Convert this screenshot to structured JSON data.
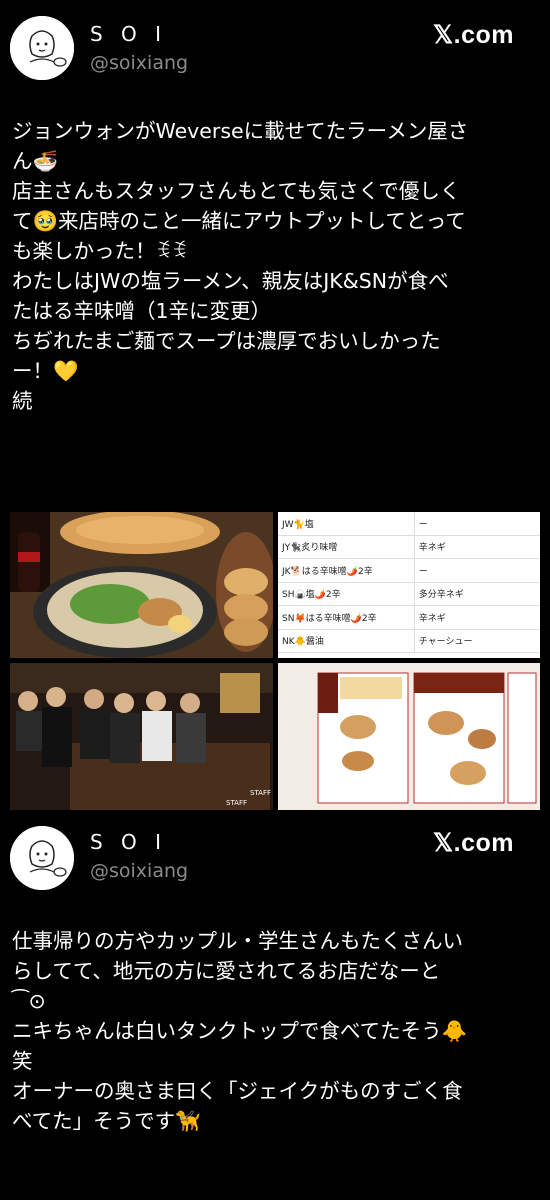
{
  "post1": {
    "author_name": "S O I",
    "author_handle": "@soixiang",
    "site": "𝕏.com",
    "lines": [
      "ジョンウォンがWeverseに載せてたラーメン屋さ",
      "ん🍜",
      "店主さんもスタッフさんもとても気さくで優しく",
      "て🥹来店時のこと一緒にアウトプットしてとって",
      "も楽しかった！ꉂꉂ",
      "わたしはJWの塩ラーメン、親友はJK&SNが食べ",
      "たはる辛味噌（1辛に変更）",
      "ちぢれたまご麺でスープは濃厚でおいしかった",
      "ー！💛",
      "続"
    ],
    "menu_rows": [
      {
        "left": "JW🐈塩",
        "right": "ー"
      },
      {
        "left": "JY🐈‍⬛炙り味噌",
        "right": "辛ネギ"
      },
      {
        "left": "JK🐕はる辛味噌🌶️2辛",
        "right": "ー"
      },
      {
        "left": "SH🍙塩🌶️2辛",
        "right": "多分辛ネギ"
      },
      {
        "left": "SN🦊はる辛味噌🌶️2辛",
        "right": "辛ネギ"
      },
      {
        "left": "NK🐥醤油",
        "right": "チャーシュー"
      }
    ],
    "photo_labels": [
      "STAFF",
      "STAFF"
    ]
  },
  "post2": {
    "author_name": "S O I",
    "author_handle": "@soixiang",
    "site": "𝕏.com",
    "lines": [
      "仕事帰りの方やカップル・学生さんもたくさんい",
      "らしてて、地元の方に愛されてるお店だなーと",
      "⁀⊙",
      "ニキちゃんは白いタンクトップで食べてたそう🐥",
      "笑",
      "オーナーの奥さま曰く「ジェイクがものすごく食",
      "べてた」そうです🦮"
    ]
  }
}
